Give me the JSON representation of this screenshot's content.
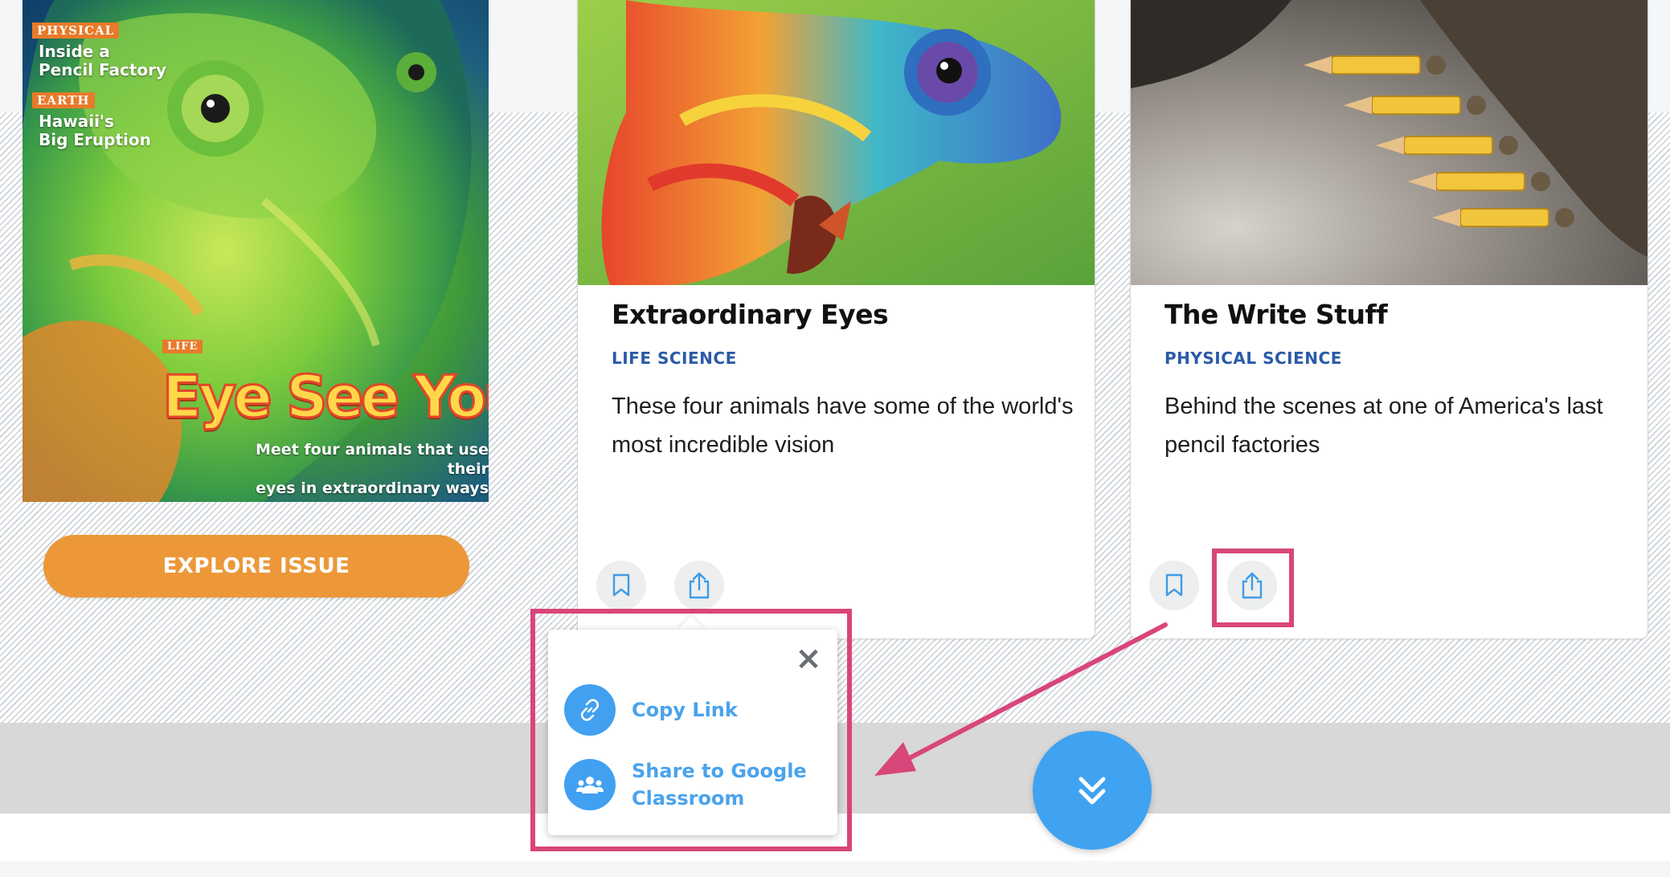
{
  "cover": {
    "tag1": "PHYSICAL",
    "line1a": "Inside a",
    "line1b": "Pencil Factory",
    "tag2": "EARTH",
    "line2a": "Hawaii's",
    "line2b": "Big Eruption",
    "tag3": "LIFE",
    "title": "Eye See You",
    "subtitle_a": "Meet four animals that use their",
    "subtitle_b": "eyes in extraordinary ways"
  },
  "explore_button": "EXPLORE ISSUE",
  "cards": [
    {
      "title": "Extraordinary Eyes",
      "category": "LIFE SCIENCE",
      "description": "These four animals have some of the world's most incredible vision",
      "bookmark_icon": "bookmark-icon",
      "share_icon": "share-icon"
    },
    {
      "title": "The Write Stuff",
      "category": "PHYSICAL SCIENCE",
      "description": "Behind the scenes at one of America's last pencil factories",
      "bookmark_icon": "bookmark-icon",
      "share_icon": "share-icon"
    }
  ],
  "share_menu": {
    "close_icon": "close-icon",
    "items": [
      {
        "label": "Copy Link",
        "icon": "link-icon"
      },
      {
        "label": "Share to Google Classroom",
        "icon": "google-classroom-icon"
      }
    ]
  },
  "scroll_button_icon": "double-chevron-down-icon",
  "colors": {
    "accent_orange": "#ec9839",
    "category_blue": "#2b5aa8",
    "link_blue": "#4aa3ec",
    "highlight_pink": "#d8467a",
    "fab_blue": "#3fa3f1"
  }
}
